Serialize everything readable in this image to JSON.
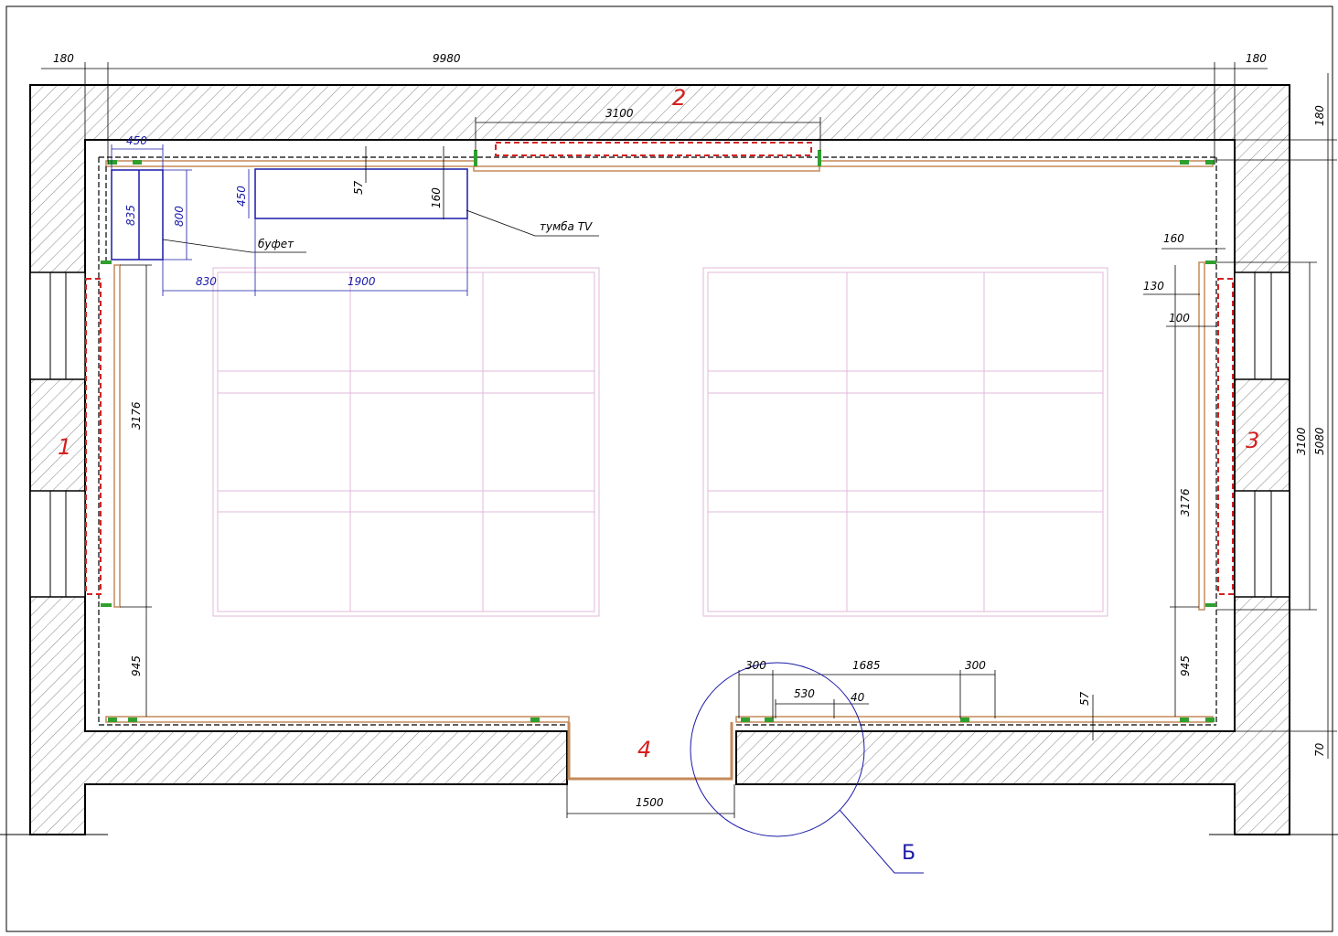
{
  "overall": {
    "width_label": "9980",
    "side_left": "180",
    "side_right": "180"
  },
  "right_dims": {
    "top_180": "180",
    "window_3100": "3100",
    "total_5080": "5080",
    "bottom_70": "70"
  },
  "top_wall": {
    "opening_3100": "3100",
    "label_2": "2",
    "dim_57": "57",
    "dim_160": "160"
  },
  "furniture": {
    "buffet_w": "450",
    "buffet_d": "835",
    "buffet_h": "800",
    "buffet_label": "буфет",
    "tv_d": "450",
    "tv_label": "тумба TV",
    "gap_830": "830",
    "tv_w_1900": "1900"
  },
  "left_wall": {
    "dim_3176": "3176",
    "dim_945": "945",
    "label_1": "1"
  },
  "right_wall": {
    "dim_160": "160",
    "dim_130": "130",
    "dim_100": "100",
    "dim_3176": "3176",
    "dim_945": "945",
    "label_3": "3"
  },
  "bottom_wall": {
    "dim_300a": "300",
    "dim_1685": "1685",
    "dim_300b": "300",
    "dim_530": "530",
    "dim_40": "40",
    "dim_57": "57",
    "door_1500": "1500",
    "label_4": "4",
    "detail_label": "Б"
  },
  "colors": {
    "wall_line": "#000000",
    "panel": "#c48a5a",
    "fastener": "#2fa02f",
    "marker_red": "#d42020",
    "furniture": "#1a1aa8",
    "ceiling_grid": "#e2b8d8"
  }
}
